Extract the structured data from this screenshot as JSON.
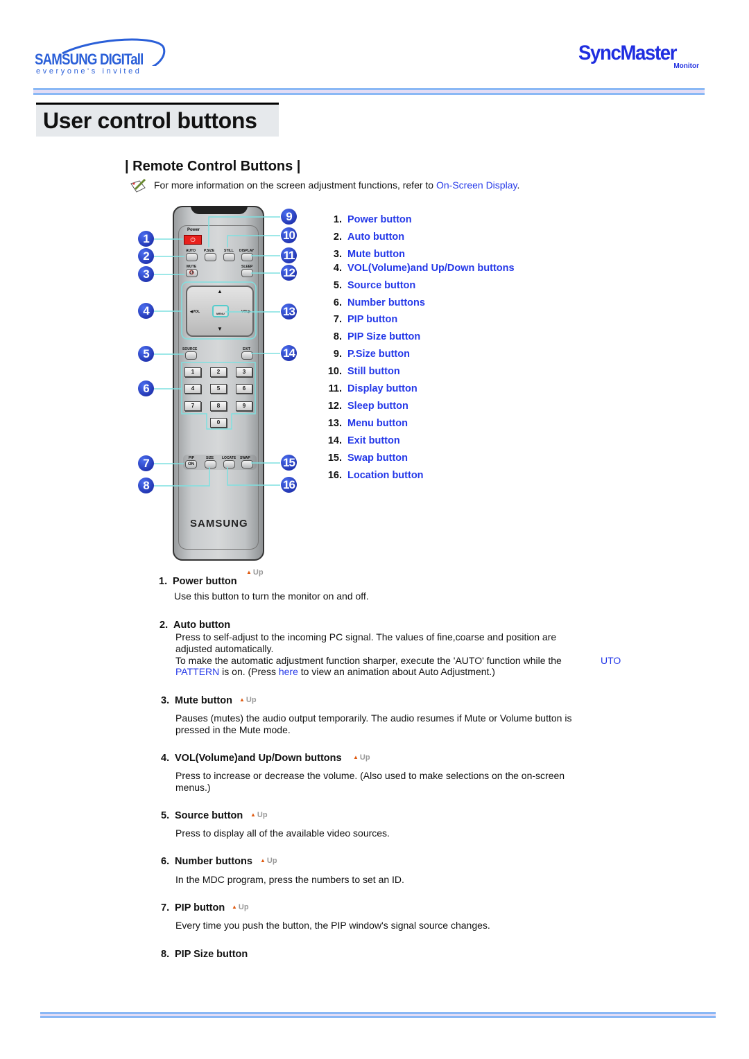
{
  "header": {
    "brand_logo": "SAMSUNG DIGITall",
    "brand_tagline": "everyone's invited",
    "product_logo": "SyncMaster",
    "product_sub": "Monitor"
  },
  "page_title": "User control buttons",
  "section_title": "| Remote Control Buttons |",
  "note": {
    "icon": "memo-pencil-icon",
    "text": "For more information on the screen adjustment functions, refer to ",
    "link": "On-Screen Display",
    "end": "."
  },
  "remote": {
    "labels": {
      "power": "Power",
      "auto": "AUTO",
      "psize": "P.SIZE",
      "still": "STILL",
      "display": "DISPLAY",
      "mute": "MUTE",
      "sleep": "SLEEP",
      "vol_left": "◀VOL",
      "vol_right": "VOL▶",
      "menu": "MENU",
      "source": "SOURCE",
      "exit": "EXIT",
      "pip": "PIP",
      "on": "ON",
      "size": "SIZE",
      "locate": "LOCATE",
      "swap": "SWAP",
      "brand": "SAMSUNG"
    },
    "numbers": [
      "1",
      "2",
      "3",
      "4",
      "5",
      "6",
      "7",
      "8",
      "9",
      "0"
    ],
    "callouts": [
      "1",
      "2",
      "3",
      "4",
      "5",
      "6",
      "7",
      "8",
      "9",
      "10",
      "11",
      "12",
      "13",
      "14",
      "15",
      "16"
    ]
  },
  "button_list": [
    {
      "num": "1.",
      "label": "Power button"
    },
    {
      "num": "2.",
      "label": "Auto button"
    },
    {
      "num": "3.",
      "label": "Mute button"
    },
    {
      "num": "4.",
      "label": "VOL(Volume)and Up/Down buttons"
    },
    {
      "num": "5.",
      "label": "Source button"
    },
    {
      "num": "6.",
      "label": "Number buttons"
    },
    {
      "num": "7.",
      "label": "PIP button"
    },
    {
      "num": "8.",
      "label": "PIP Size button"
    },
    {
      "num": "9.",
      "label": "P.Size button"
    },
    {
      "num": "10.",
      "label": "Still button"
    },
    {
      "num": "11.",
      "label": "Display button"
    },
    {
      "num": "12.",
      "label": "Sleep button"
    },
    {
      "num": "13.",
      "label": "Menu button"
    },
    {
      "num": "14.",
      "label": "Exit button"
    },
    {
      "num": "15.",
      "label": "Swap button"
    },
    {
      "num": "16.",
      "label": "Location button"
    }
  ],
  "up_label": "Up",
  "sections": [
    {
      "num": "1.",
      "title": "Power button",
      "desc": [
        "Use this button to turn the monitor on and off."
      ]
    },
    {
      "num": "2.",
      "title": "Auto button",
      "desc": [
        "Press to self-adjust to the incoming PC signal. The values of fine,coarse and position are",
        "adjusted automatically.",
        "To make the automatic adjustment function sharper, execute the 'AUTO' function while the"
      ],
      "link1a": "UTO",
      "link1b": "PATTERN",
      "mid": " is on. (Press ",
      "link2": "here",
      "tail": " to view an animation about Auto Adjustment.)"
    },
    {
      "num": "3.",
      "title": "Mute button",
      "desc": [
        "Pauses (mutes) the audio output temporarily. The audio resumes if Mute or Volume button is",
        "pressed in the Mute mode."
      ]
    },
    {
      "num": "4.",
      "title": "VOL(Volume)and Up/Down buttons",
      "desc": [
        "Press to increase or decrease the volume. (Also used to make selections on the on-screen",
        "menus.)"
      ]
    },
    {
      "num": "5.",
      "title": "Source button",
      "desc": [
        "Press to display all of the available video sources."
      ]
    },
    {
      "num": "6.",
      "title": "Number buttons",
      "desc": [
        "In the MDC program, press the numbers to set an ID."
      ]
    },
    {
      "num": "7.",
      "title": "PIP button",
      "desc": [
        "Every time you push the button, the PIP window's signal source changes."
      ]
    },
    {
      "num": "8.",
      "title": "PIP Size button"
    }
  ],
  "colors": {
    "link": "#2438e8",
    "callout": "#1a2fb8",
    "callout_line": "#7fe0e0",
    "rule_blue": "#8ab8f5",
    "rule_lavender": "#e2dcf5",
    "title_bg": "#e6e9ec",
    "power_red": "#e8201c"
  }
}
